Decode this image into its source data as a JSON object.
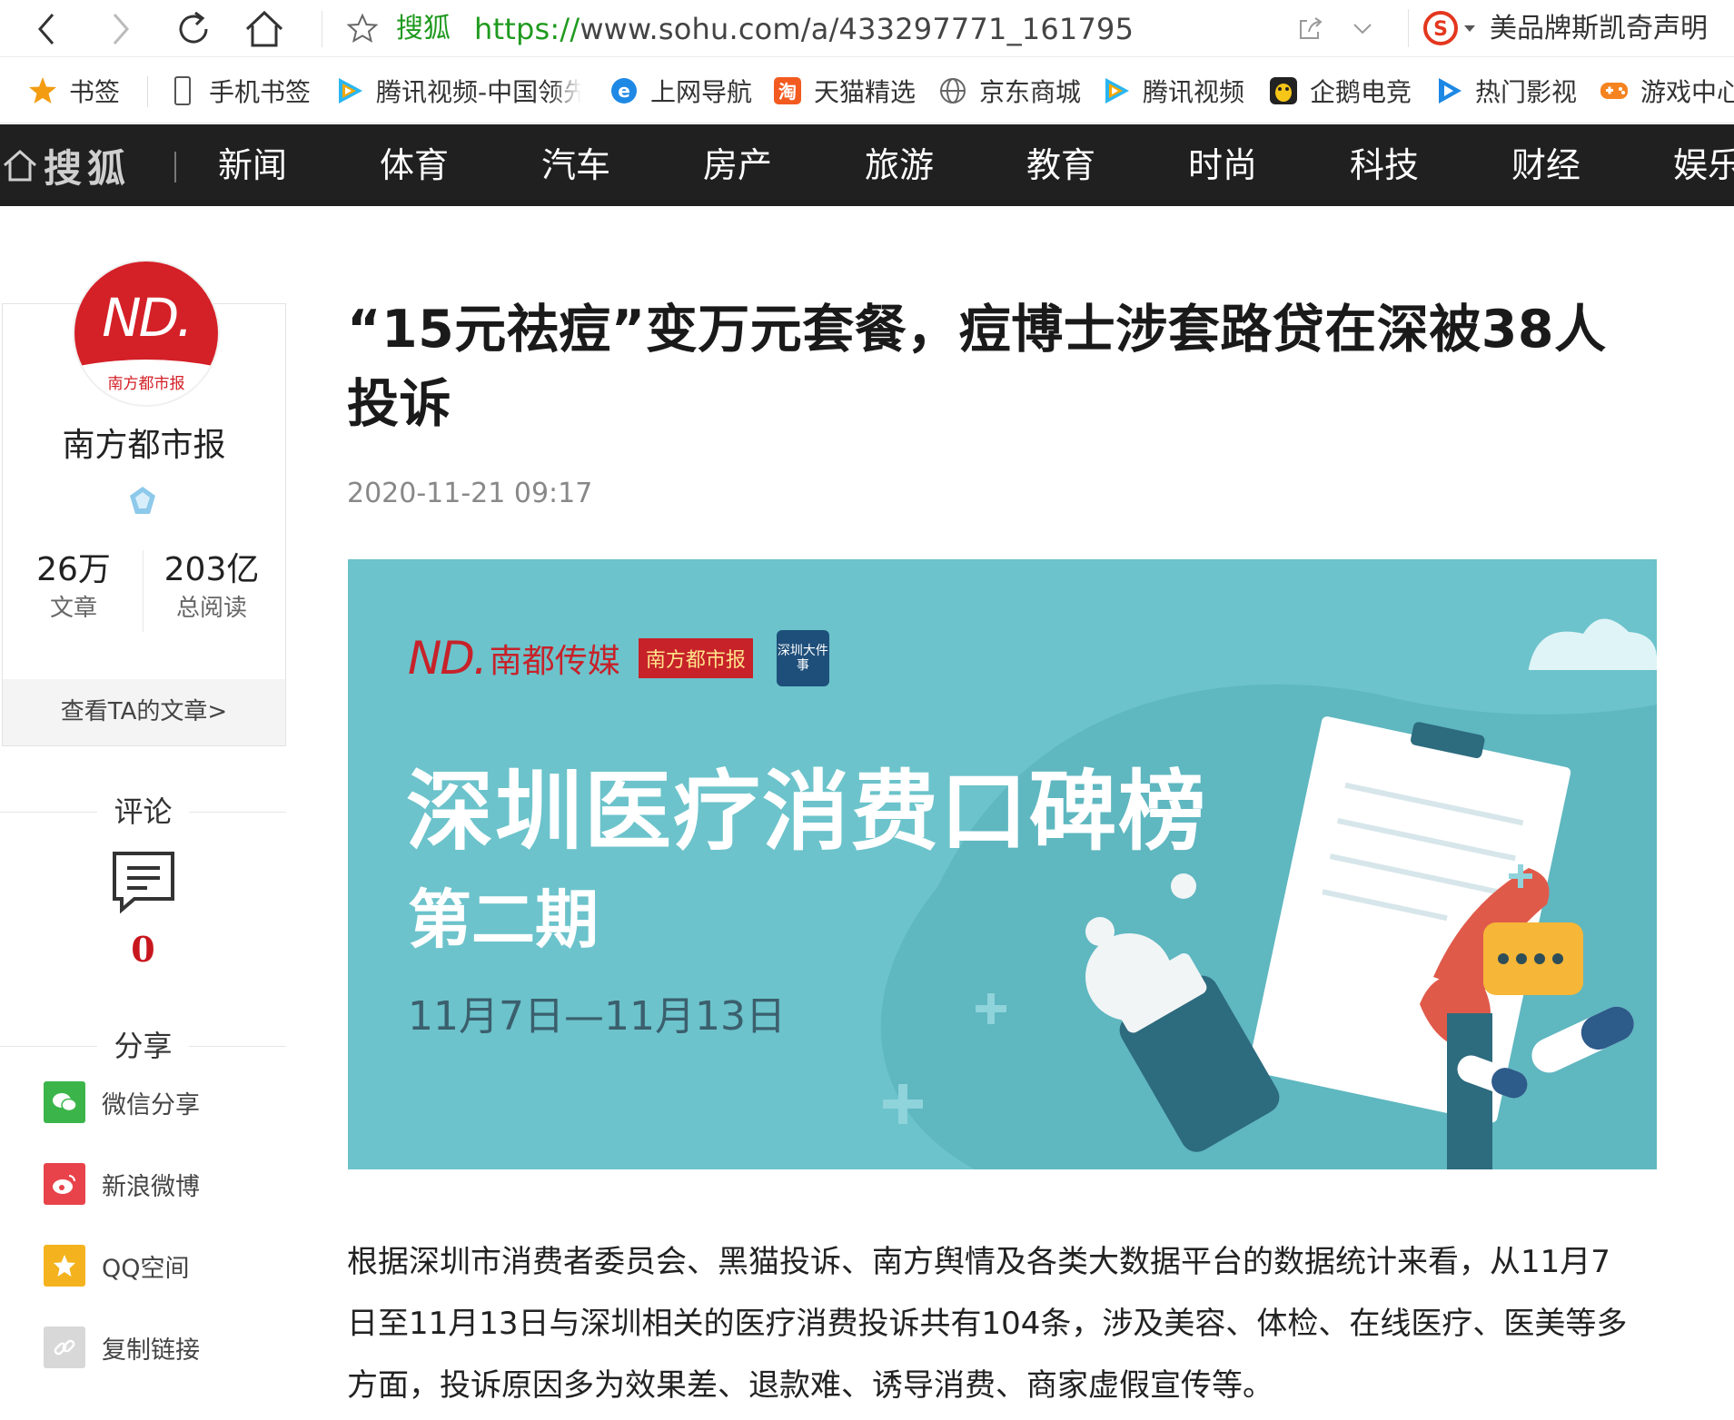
{
  "browser": {
    "site_name": "搜狐",
    "url_scheme": "https://",
    "url_rest": "www.sohu.com/a/433297771_161795",
    "hot_search": "美品牌斯凯奇声明"
  },
  "bookmarks": [
    {
      "label": "书签",
      "icon": "star-icon"
    },
    {
      "label": "手机书签",
      "icon": "phone-icon"
    },
    {
      "label": "腾讯视频-中国领先",
      "icon": "tencent-video-icon"
    },
    {
      "label": "上网导航",
      "icon": "ie-icon"
    },
    {
      "label": "天猫精选",
      "icon": "taobao-icon"
    },
    {
      "label": "京东商城",
      "icon": "globe-icon"
    },
    {
      "label": "腾讯视频",
      "icon": "tencent-video-icon"
    },
    {
      "label": "企鹅电竞",
      "icon": "penguin-icon"
    },
    {
      "label": "热门影视",
      "icon": "play-icon"
    },
    {
      "label": "游戏中心",
      "icon": "gamepad-icon"
    }
  ],
  "sohu_nav": {
    "logo": "搜狐",
    "items": [
      "新闻",
      "体育",
      "汽车",
      "房产",
      "旅游",
      "教育",
      "时尚",
      "科技",
      "财经",
      "娱乐"
    ]
  },
  "author": {
    "avatar_text": "南方都市报",
    "name": "南方都市报",
    "articles_num": "26万",
    "articles_label": "文章",
    "reads_num": "203亿",
    "reads_label": "总阅读",
    "link": "查看TA的文章>"
  },
  "comments": {
    "heading": "评论",
    "count": "0"
  },
  "share": {
    "heading": "分享",
    "items": [
      {
        "label": "微信分享",
        "color": "#3bb54a"
      },
      {
        "label": "新浪微博",
        "color": "#e8434a"
      },
      {
        "label": "QQ空间",
        "color": "#f4b31e"
      },
      {
        "label": "复制链接",
        "color": "#d8d8d8"
      }
    ]
  },
  "article": {
    "title": "“15元祛痘”变万元套餐，痘博士涉套路贷在深被38人投诉",
    "date": "2020-11-21 09:17",
    "banner": {
      "logo_text": "南都传媒",
      "badge": "南方都市报",
      "badge2": "深圳大件事",
      "title": "深圳医疗消费口碑榜",
      "subtitle": "第二期",
      "date_range": "11月7日—11月13日"
    },
    "body": "根据深圳市消费者委员会、黑猫投诉、南方舆情及各类大数据平台的数据统计来看，从11月7日至11月13日与深圳相关的医疗消费投诉共有104条，涉及美容、体检、在线医疗、医美等多方面，投诉原因多为效果差、退款难、诱导消费、商家虚假宣传等。"
  }
}
